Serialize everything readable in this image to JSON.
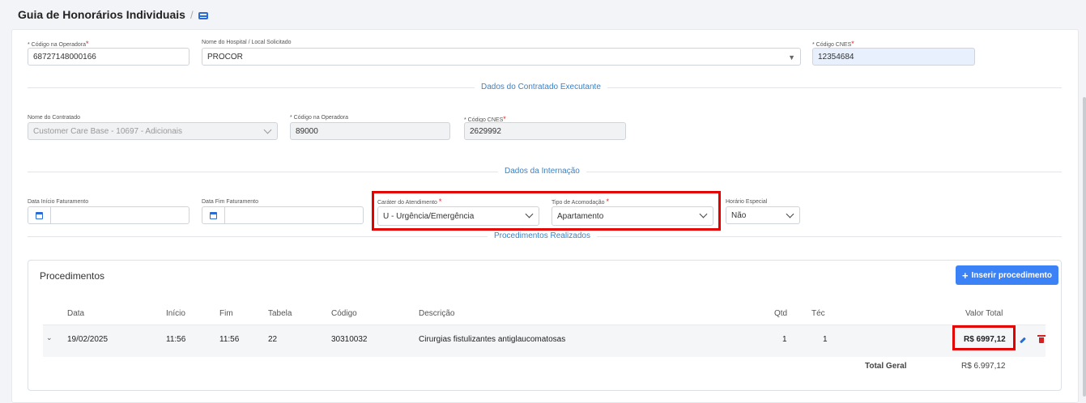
{
  "header": {
    "title": "Guia de Honorários Individuais",
    "separator": "/"
  },
  "top": {
    "codigo_operadora": {
      "label": "* Código na Operadora",
      "req": "*",
      "value": "68727148000166"
    },
    "hospital": {
      "label": "Nome do Hospital / Local Solicitado",
      "value": "PROCOR"
    },
    "cnes": {
      "label": "* Código CNES",
      "req": "*",
      "value": "12354684"
    }
  },
  "section_contratado": {
    "title": "Dados do Contratado Executante",
    "nome": {
      "label": "Nome do Contratado",
      "value": "Customer Care Base - 10697 - Adicionais"
    },
    "codigo_operadora": {
      "label": "* Código na Operadora",
      "value": "89000"
    },
    "cnes": {
      "label": "* Código CNES",
      "req": "*",
      "value": "2629992"
    }
  },
  "section_internacao": {
    "title": "Dados da Internação",
    "data_inicio": {
      "label": "Data Início Faturamento",
      "value": ""
    },
    "data_fim": {
      "label": "Data Fim Faturamento",
      "value": ""
    },
    "carater": {
      "label": "Caráter do Atendimento",
      "req": "*",
      "value": "U - Urgência/Emergência"
    },
    "acomodacao": {
      "label": "Tipo de Acomodação",
      "req": "*",
      "value": "Apartamento"
    },
    "horario": {
      "label": "Horário Especial",
      "value": "Não"
    }
  },
  "section_procedimentos": {
    "title": "Procedimentos Realizados"
  },
  "procedimentos": {
    "title": "Procedimentos",
    "insert_button": "Inserir procedimento",
    "columns": [
      "Data",
      "Início",
      "Fim",
      "Tabela",
      "Código",
      "Descrição",
      "Qtd",
      "Téc",
      "Valor Total"
    ],
    "rows": [
      {
        "data": "19/02/2025",
        "inicio": "11:56",
        "fim": "11:56",
        "tabela": "22",
        "codigo": "30310032",
        "descricao": "Cirurgias fistulizantes antiglaucomatosas",
        "qtd": "1",
        "tec": "1",
        "valor": "R$ 6997,12"
      }
    ],
    "total_label": "Total Geral",
    "total_value": "R$ 6.997,12"
  },
  "colors": {
    "accent": "#3b82f6",
    "highlight": "#e50000",
    "section_title": "#3b82c4"
  },
  "icons": {
    "header": "credit-card-icon",
    "calendar": "calendar-icon",
    "edit": "pencil-icon",
    "delete": "trash-icon",
    "expand": "chevron-down-icon"
  }
}
